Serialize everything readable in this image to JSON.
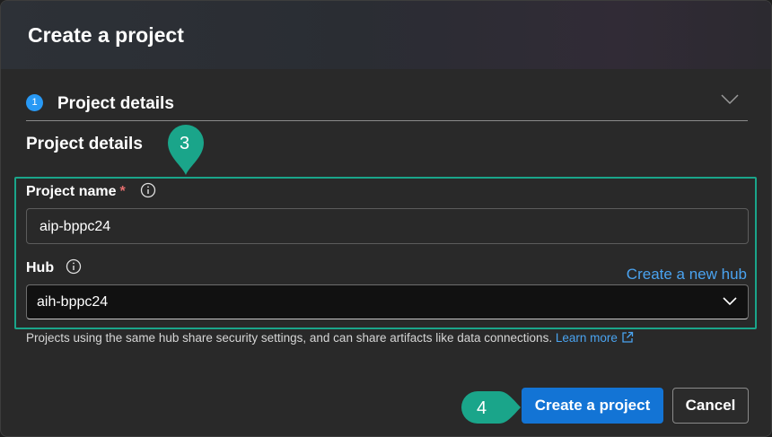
{
  "dialog": {
    "title": "Create a project"
  },
  "step": {
    "number": "1",
    "label": "Project details"
  },
  "section": {
    "title": "Project details"
  },
  "project_name": {
    "label": "Project name",
    "required_mark": "*",
    "value": "aip-bppc24"
  },
  "hub": {
    "label": "Hub",
    "create_link": "Create a new hub",
    "selected": "aih-bppc24"
  },
  "helper": {
    "text": "Projects using the same hub share security settings, and can share artifacts like data connections.",
    "link": "Learn more"
  },
  "buttons": {
    "create": "Create a project",
    "cancel": "Cancel"
  },
  "callouts": {
    "first": "3",
    "second": "4"
  },
  "colors": {
    "accent": "#1374d5",
    "callout": "#1aa58a",
    "link": "#4aa3f0",
    "required": "#e46e6e"
  },
  "icons": {
    "step_chevron": "chevron-down-icon",
    "info": "info-icon",
    "select_chevron": "chevron-down-icon",
    "external_link": "external-link-icon"
  }
}
